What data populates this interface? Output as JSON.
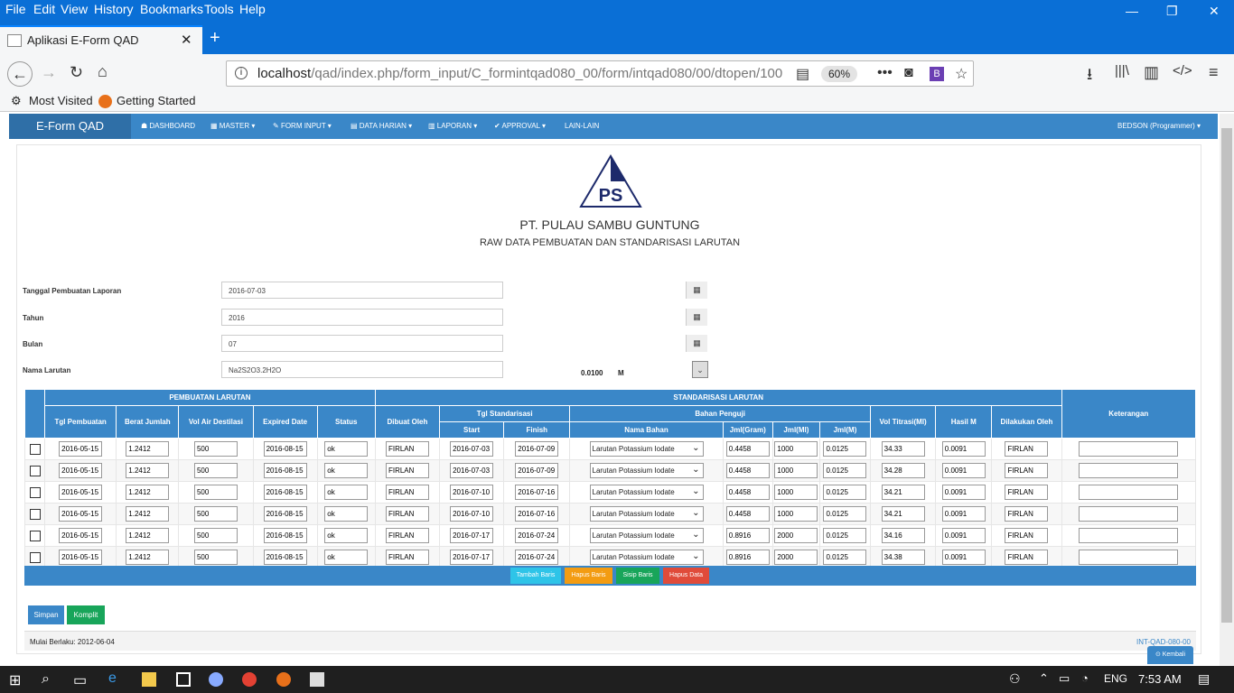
{
  "menubar": {
    "items": [
      "File",
      "Edit",
      "View",
      "History",
      "Bookmarks",
      "Tools",
      "Help"
    ]
  },
  "window_controls": {
    "minimize": "—",
    "maximize": "❐",
    "close": "✕"
  },
  "tab": {
    "title": "Aplikasi E-Form QAD",
    "close": "✕",
    "new_tab": "+"
  },
  "navbar": {
    "url_host": "localhost",
    "url_path": "/qad/index.php/form_input/C_formintqad080_00/form/intqad080/00/dtopen/100",
    "zoom": "60%"
  },
  "bookmarks": [
    "Most Visited",
    "Getting Started"
  ],
  "app": {
    "brand": "E-Form QAD",
    "nav": [
      "DASHBOARD",
      "MASTER",
      "FORM INPUT",
      "DATA HARIAN",
      "LAPORAN",
      "APPROVAL",
      "LAIN-LAIN"
    ],
    "user": "BEDSON (Programmer)",
    "logo_text": "PS",
    "company": "PT. PULAU SAMBU GUNTUNG",
    "subtitle": "RAW DATA PEMBUATAN DAN STANDARISASI LARUTAN",
    "fields": [
      {
        "label": "Tanggal Pembuatan Laporan",
        "value": "2016-07-03"
      },
      {
        "label": "Tahun",
        "value": "2016"
      },
      {
        "label": "Bulan",
        "value": "07"
      },
      {
        "label": "Nama Larutan",
        "value": "Na2S2O3.2H2O"
      }
    ],
    "concentration": "0.0100",
    "concentration_unit": "M",
    "table": {
      "group1": "PEMBUATAN LARUTAN",
      "group2": "STANDARISASI LARUTAN",
      "tgl_std": "Tgl Standarisasi",
      "bahan": "Bahan Penguji",
      "headers": [
        "Tgl Pembuatan",
        "Berat Jumlah",
        "Vol Air Destilasi",
        "Expired Date",
        "Status",
        "Dibuat Oleh",
        "Start",
        "Finish",
        "Nama Bahan",
        "Jml(Gram)",
        "Jml(Ml)",
        "Jml(M)",
        "Vol Titrasi(Ml)",
        "Hasil M",
        "Dilakukan Oleh",
        "Keterangan"
      ],
      "rows": [
        [
          "2016-05-15",
          "1.2412",
          "500",
          "2016-08-15",
          "ok",
          "FIRLAN",
          "2016-07-03",
          "2016-07-09",
          "Larutan Potassium Iodate",
          "0.4458",
          "1000",
          "0.0125",
          "34.33",
          "0.0091",
          "FIRLAN",
          ""
        ],
        [
          "2016-05-15",
          "1.2412",
          "500",
          "2016-08-15",
          "ok",
          "FIRLAN",
          "2016-07-03",
          "2016-07-09",
          "Larutan Potassium Iodate",
          "0.4458",
          "1000",
          "0.0125",
          "34.28",
          "0.0091",
          "FIRLAN",
          ""
        ],
        [
          "2016-05-15",
          "1.2412",
          "500",
          "2016-08-15",
          "ok",
          "FIRLAN",
          "2016-07-10",
          "2016-07-16",
          "Larutan Potassium Iodate",
          "0.4458",
          "1000",
          "0.0125",
          "34.21",
          "0.0091",
          "FIRLAN",
          ""
        ],
        [
          "2016-05-15",
          "1.2412",
          "500",
          "2016-08-15",
          "ok",
          "FIRLAN",
          "2016-07-10",
          "2016-07-16",
          "Larutan Potassium Iodate",
          "0.4458",
          "1000",
          "0.0125",
          "34.21",
          "0.0091",
          "FIRLAN",
          ""
        ],
        [
          "2016-05-15",
          "1.2412",
          "500",
          "2016-08-15",
          "ok",
          "FIRLAN",
          "2016-07-17",
          "2016-07-24",
          "Larutan Potassium Iodate",
          "0.8916",
          "2000",
          "0.0125",
          "34.16",
          "0.0091",
          "FIRLAN",
          ""
        ],
        [
          "2016-05-15",
          "1.2412",
          "500",
          "2016-08-15",
          "ok",
          "FIRLAN",
          "2016-07-17",
          "2016-07-24",
          "Larutan Potassium Iodate",
          "0.8916",
          "2000",
          "0.0125",
          "34.38",
          "0.0091",
          "FIRLAN",
          ""
        ]
      ]
    },
    "actions": [
      "Tambah Baris",
      "Hapus Baris",
      "Sisip Baris",
      "Hapus Data"
    ],
    "save": "Simpan",
    "complete": "Komplit",
    "footer_left": "Mulai Berlaku: 2012-06-04",
    "footer_right": "INT-QAD-080-00",
    "back": "Kembali"
  },
  "taskbar": {
    "lang": "ENG",
    "time": "7:53 AM"
  }
}
